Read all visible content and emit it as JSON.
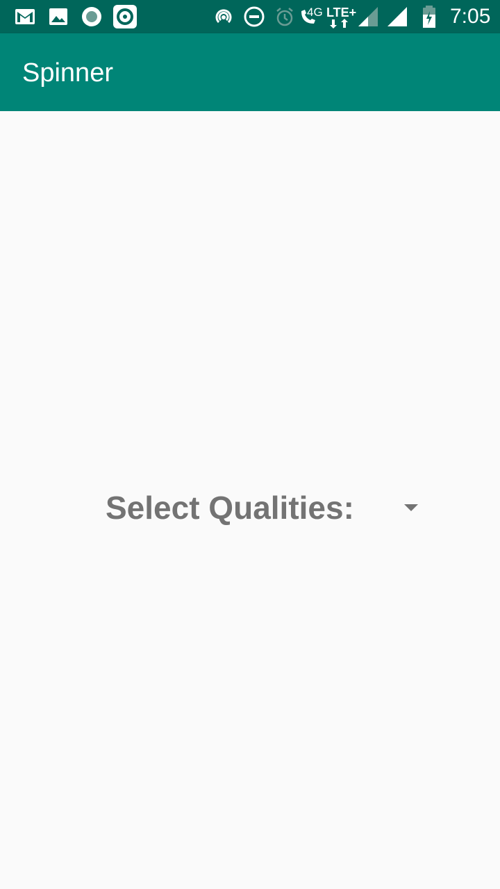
{
  "status_bar": {
    "time": "7:05",
    "network_4g": "4G",
    "network_lte": "LTE+",
    "icons": [
      "gmail-icon",
      "image-icon",
      "record-icon",
      "target-icon",
      "hotspot-icon",
      "dnd-icon",
      "alarm-icon",
      "wifi-calling-icon",
      "lte-data-icon",
      "signal-icon",
      "signal-icon-2",
      "battery-icon"
    ]
  },
  "app_bar": {
    "title": "Spinner"
  },
  "spinner": {
    "label": "Select Qualities:",
    "arrow_icon": "dropdown-arrow-icon"
  },
  "colors": {
    "status_bar": "#00665a",
    "app_bar": "#008577",
    "background": "#fafafa",
    "label": "#737373"
  }
}
